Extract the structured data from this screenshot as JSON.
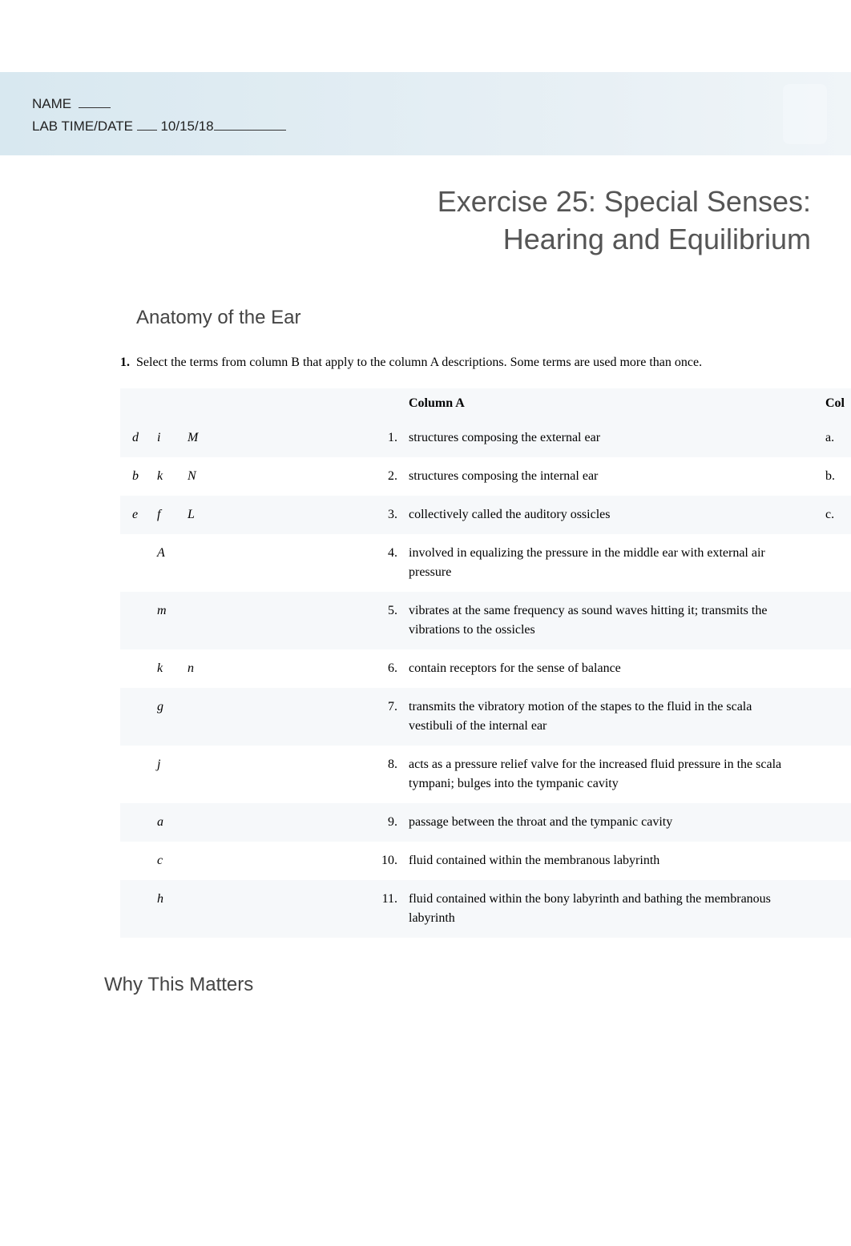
{
  "header": {
    "name_label": "NAME",
    "date_label": "LAB TIME/DATE",
    "date_value": "10/15/18"
  },
  "title_line1": "Exercise 25: Special Senses:",
  "title_line2": "Hearing and Equilibrium",
  "section1_heading": "Anatomy of the Ear",
  "instruction": {
    "num": "1.",
    "text": "Select the terms from column B that apply to the column A descriptions. Some terms are used more than once."
  },
  "table": {
    "header_a": "Column A",
    "header_b": "Col",
    "rows": [
      {
        "answers": [
          "d",
          "i",
          "M"
        ],
        "num": "1.",
        "desc": "structures composing the external ear",
        "b": "a."
      },
      {
        "answers": [
          "b",
          "k",
          "N"
        ],
        "num": "2.",
        "desc": "structures composing the internal ear",
        "b": "b."
      },
      {
        "answers": [
          "e",
          "f",
          "L"
        ],
        "num": "3.",
        "desc": "collectively called the auditory ossicles",
        "b": "c."
      },
      {
        "answers": [
          "",
          "A",
          ""
        ],
        "num": "4.",
        "desc": "involved in equalizing the pressure in the middle ear with external air pressure",
        "b": ""
      },
      {
        "answers": [
          "",
          "m",
          ""
        ],
        "num": "5.",
        "desc": "vibrates at the same frequency as sound waves hitting it; transmits the vibrations to the ossicles",
        "b": ""
      },
      {
        "answers": [
          "",
          "k",
          "n"
        ],
        "num": "6.",
        "desc": "contain receptors for the sense of balance",
        "b": ""
      },
      {
        "answers": [
          "",
          "g",
          ""
        ],
        "num": "7.",
        "desc": "transmits the vibratory motion of the stapes to the fluid in the scala vestibuli of the internal ear",
        "b": ""
      },
      {
        "answers": [
          "",
          "j",
          ""
        ],
        "num": "8.",
        "desc": "acts as a pressure relief valve for the increased fluid pressure in the scala tympani; bulges into the tympanic cavity",
        "b": ""
      },
      {
        "answers": [
          "",
          "a",
          ""
        ],
        "num": "9.",
        "desc": "passage between the throat and the tympanic cavity",
        "b": ""
      },
      {
        "answers": [
          "",
          "c",
          ""
        ],
        "num": "10.",
        "desc": "fluid contained within the membranous labyrinth",
        "b": ""
      },
      {
        "answers": [
          "",
          "h",
          ""
        ],
        "num": "11.",
        "desc": "fluid contained within the bony labyrinth and bathing the membranous labyrinth",
        "b": ""
      }
    ]
  },
  "section2_heading": "Why This Matters"
}
